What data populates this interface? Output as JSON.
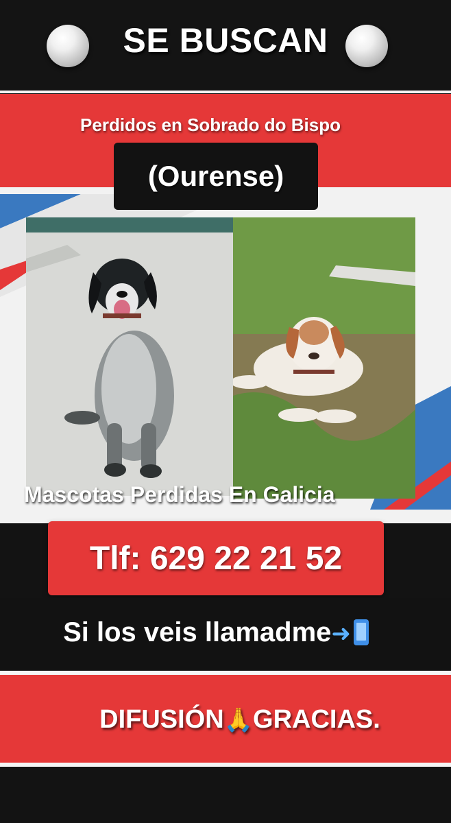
{
  "header": {
    "title": "SE BUSCAN",
    "left_icon": "white-circle-icon",
    "right_icon": "white-circle-icon"
  },
  "location": {
    "line": "Perdidos en Sobrado do Bispo",
    "province": "(Ourense)"
  },
  "photos": {
    "left": "black-and-white-pointer-dog-photo",
    "right": "white-and-brown-pointer-dog-photo",
    "watermark": "Mascotas Perdidas En Galicia"
  },
  "contact": {
    "phone": "Tlf: 629 22 21 52",
    "call_text": "Si los veis llamadme",
    "call_icon": "mobile-phone-with-arrow-icon"
  },
  "closing": {
    "left": "DIFUSIÓN",
    "icon": "folded-hands-icon",
    "right": "GRACIAS."
  },
  "colors": {
    "red": "#e53838",
    "black": "#131313",
    "white": "#ffffff"
  }
}
